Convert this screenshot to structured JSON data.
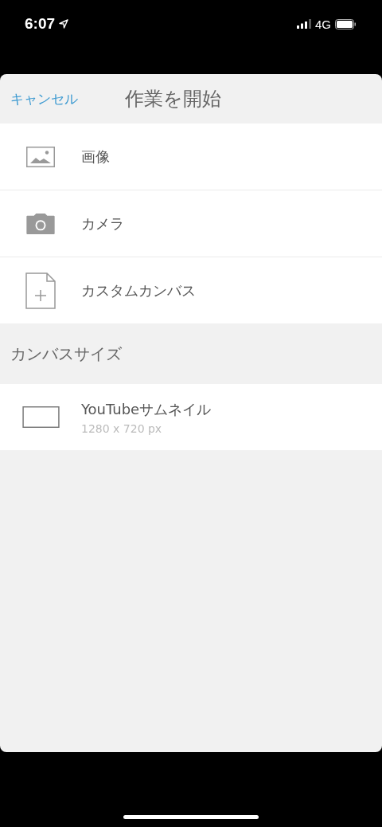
{
  "status_bar": {
    "time": "6:07",
    "network": "4G"
  },
  "sheet": {
    "cancel": "キャンセル",
    "title": "作業を開始"
  },
  "actions": [
    {
      "kind": "image",
      "label": "画像"
    },
    {
      "kind": "camera",
      "label": "カメラ"
    },
    {
      "kind": "document",
      "label": "カスタムカンバス"
    }
  ],
  "section": {
    "title": "カンバスサイズ"
  },
  "presets": [
    {
      "kind": "frame",
      "name": "YouTubeサムネイル",
      "size": "1280 x 720 px"
    }
  ]
}
